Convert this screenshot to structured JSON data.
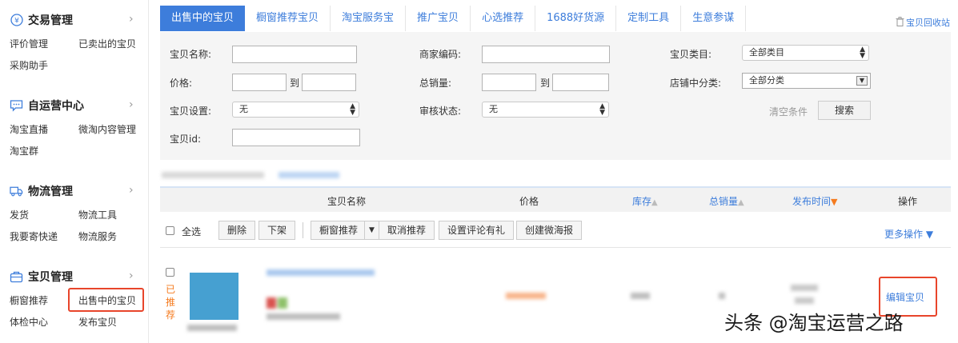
{
  "sidebar": {
    "groups": [
      {
        "title": "交易管理",
        "icon": "yen-icon",
        "items": [
          "评价管理",
          "已卖出的宝贝",
          "采购助手"
        ]
      },
      {
        "title": "自运营中心",
        "icon": "chat-bubble-icon",
        "items": [
          "淘宝直播",
          "微淘内容管理",
          "淘宝群"
        ]
      },
      {
        "title": "物流管理",
        "icon": "truck-icon",
        "items": [
          "发货",
          "物流工具",
          "我要寄快递",
          "物流服务"
        ]
      },
      {
        "title": "宝贝管理",
        "icon": "bag-icon",
        "items": [
          "橱窗推荐",
          "出售中的宝贝",
          "体检中心",
          "发布宝贝"
        ]
      }
    ],
    "chevron": "›"
  },
  "tabs": [
    "出售中的宝贝",
    "橱窗推荐宝贝",
    "淘宝服务宝",
    "推广宝贝",
    "心选推荐",
    "1688好货源",
    "定制工具",
    "生意参谋"
  ],
  "recycle_label": "宝贝回收站",
  "filters": {
    "name_label": "宝贝名称:",
    "code_label": "商家编码:",
    "category_label": "宝贝类目:",
    "category_value": "全部类目",
    "price_label": "价格:",
    "sales_label": "总销量:",
    "to_label": "到",
    "shop_category_label": "店铺中分类:",
    "shop_category_value": "全部分类",
    "setting_label": "宝贝设置:",
    "setting_value": "无",
    "audit_label": "审核状态:",
    "audit_value": "无",
    "id_label": "宝贝id:",
    "clear_label": "清空条件",
    "search_label": "搜索"
  },
  "table": {
    "headers": {
      "name": "宝贝名称",
      "price": "价格",
      "stock": "库存",
      "sales": "总销量",
      "publish_time": "发布时间",
      "operation": "操作"
    },
    "sort_up": "▲",
    "sort_down": "▼"
  },
  "actions": {
    "select_all": "全选",
    "delete": "删除",
    "unlist": "下架",
    "window_recommend": "橱窗推荐",
    "cancel_recommend": "取消推荐",
    "review_gift": "设置评论有礼",
    "create_poster": "创建微海报",
    "more": "更多操作 ▼"
  },
  "row": {
    "recommended": "已推荐",
    "edit": "编辑宝贝"
  },
  "watermark": "头条 @淘宝运营之路",
  "colors": {
    "accent": "#3d7ddb",
    "highlight": "#e8452b",
    "orange": "#f57b1f"
  }
}
